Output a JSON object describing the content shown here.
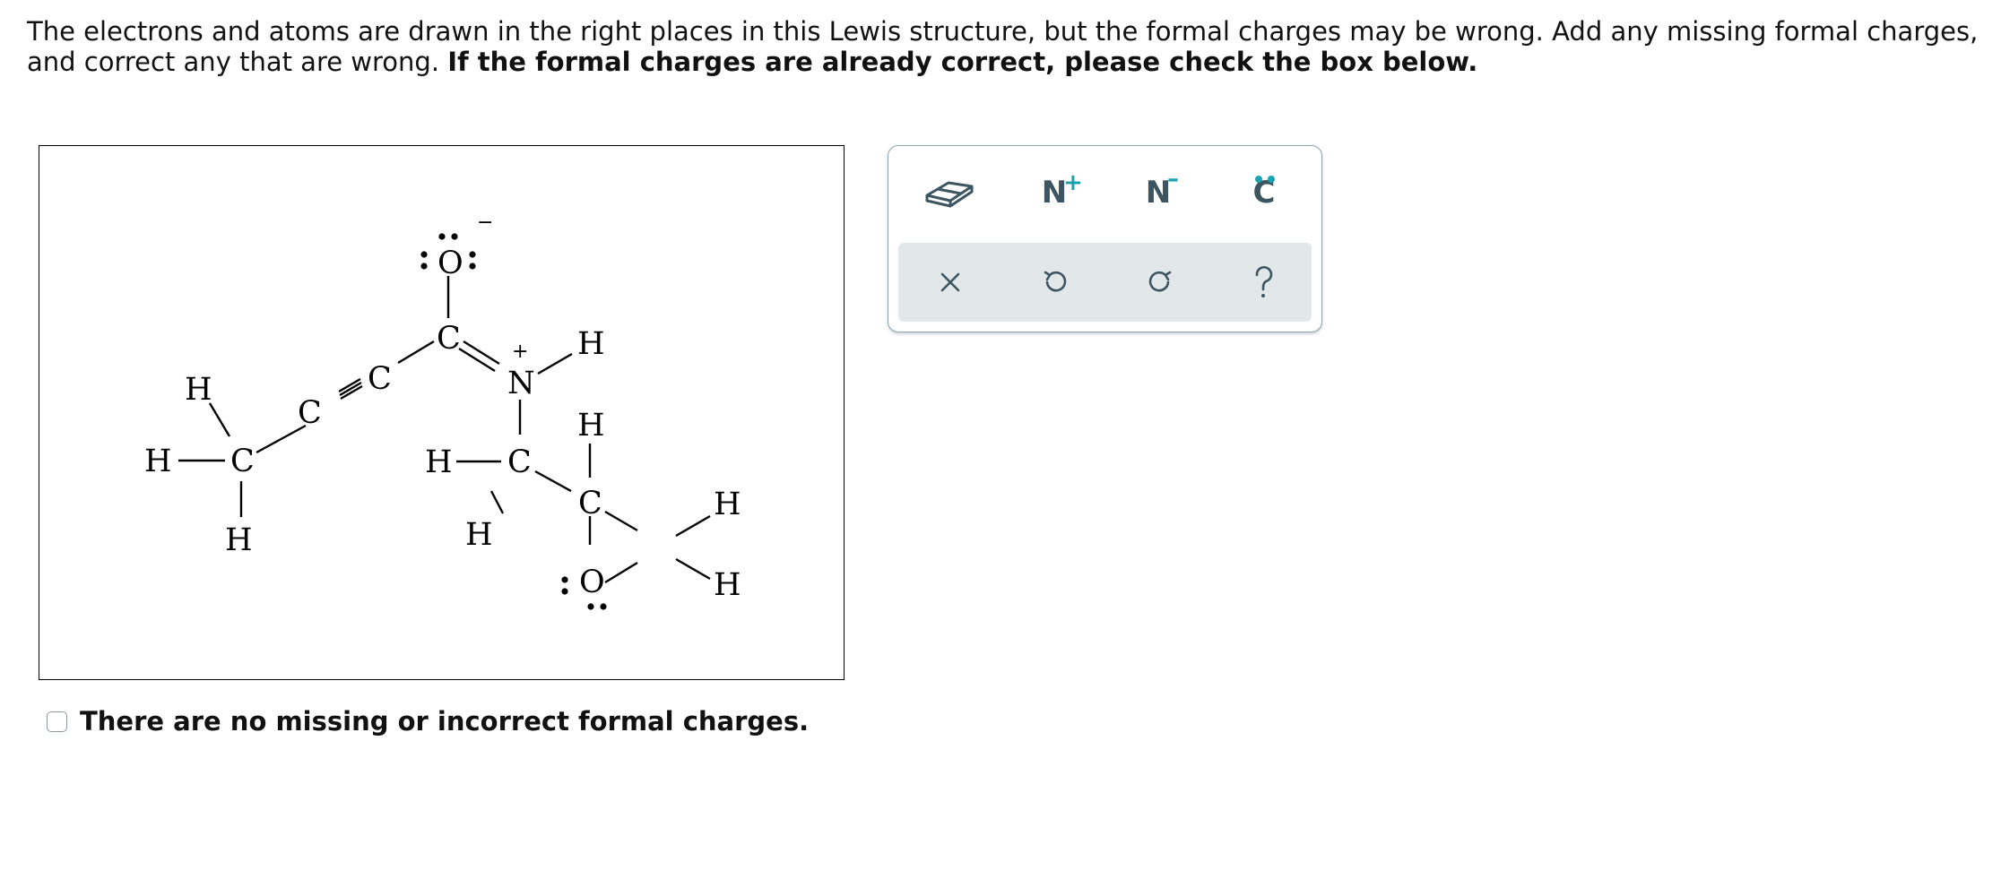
{
  "question": {
    "text": "The electrons and atoms are drawn in the right places in this Lewis structure, but the formal charges may be wrong. Add any missing formal charges, and correct any that are wrong. ",
    "bold_text": "If the formal charges are already correct, please check the box below."
  },
  "molecule": {
    "atoms": {
      "O1": "O",
      "C1": "C",
      "C2": "C",
      "C3": "C",
      "N1": "N",
      "H_N": "H",
      "H1": "H",
      "H2": "H",
      "H3": "H",
      "C4": "C",
      "H4": "H",
      "H5": "H",
      "H6": "H",
      "C5": "C",
      "O2": "O",
      "C6": "C",
      "H7": "H",
      "H8": "H"
    },
    "charges": {
      "O1_charge": "−",
      "N1_charge": "+"
    }
  },
  "toolbox": {
    "tools": [
      {
        "name": "eraser",
        "icon": "eraser-icon"
      },
      {
        "name": "add-positive-charge",
        "label": "N",
        "sup": "+"
      },
      {
        "name": "add-negative-charge",
        "label": "N",
        "sup": "–"
      },
      {
        "name": "add-lone-pair",
        "label": "C"
      }
    ],
    "actions": [
      {
        "name": "clear",
        "icon": "close-icon"
      },
      {
        "name": "undo",
        "icon": "undo-icon"
      },
      {
        "name": "redo",
        "icon": "redo-icon"
      },
      {
        "name": "help",
        "icon": "help-icon"
      }
    ],
    "colors": {
      "icon": "#3d5561",
      "accent": "#1aa3b0",
      "row_bg": "#e2e7e9"
    }
  },
  "checkbox": {
    "label": "There are no missing or incorrect formal charges.",
    "checked": false
  }
}
